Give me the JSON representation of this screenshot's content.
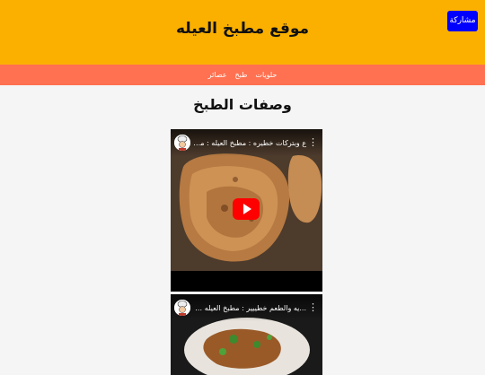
{
  "header": {
    "site_title": "موقع مطبخ العيله",
    "share_label": "مشاركة",
    "background": "#fbb000"
  },
  "nav": {
    "background": "#ff7150",
    "items": [
      {
        "label": "حلويات"
      },
      {
        "label": "طبخ"
      },
      {
        "label": "عصائر"
      }
    ]
  },
  "main": {
    "heading": "وصفات الطبخ",
    "videos": [
      {
        "title": "ع وبتركات خطيره : مطبخ العيله : مطبخ العيله",
        "more_icon": "more-vert-icon",
        "play_icon": "youtube-play-icon"
      },
      {
        "title": "...يه والطعم خطييير : مطبخ العيله : مطبخ العيله",
        "more_icon": "more-vert-icon"
      }
    ]
  },
  "colors": {
    "play_button": "#ff0000",
    "share_button": "#0000ff"
  }
}
